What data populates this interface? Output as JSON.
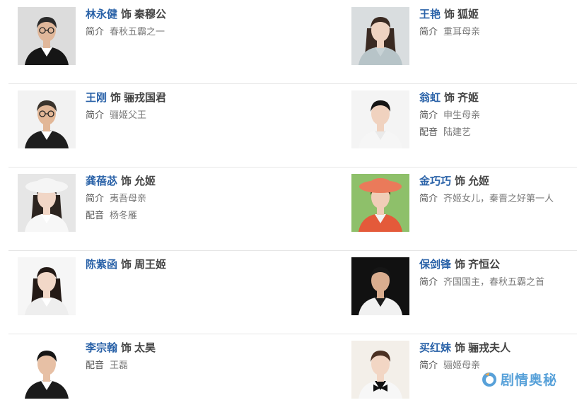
{
  "sep": "饰",
  "cast": [
    {
      "actor": "林永健",
      "role": "秦穆公",
      "details": [
        {
          "label": "简介",
          "value": "春秋五霸之一"
        }
      ],
      "photo": {
        "bg": "#dcdcdc",
        "skin": "#e0b79a",
        "hair": "#2a2a2a",
        "cloth": "#161616",
        "collar": "#ffffff",
        "glasses": true
      }
    },
    {
      "actor": "王艳",
      "role": "狐姬",
      "details": [
        {
          "label": "简介",
          "value": "重耳母亲"
        }
      ],
      "photo": {
        "bg": "#d9dddf",
        "skin": "#efd3c1",
        "hair": "#3a2a22",
        "cloth": "#b7c4c8",
        "collar": "#c8d3d6",
        "longhair": true
      }
    },
    {
      "actor": "王刚",
      "role": "骊戎国君",
      "details": [
        {
          "label": "简介",
          "value": "骊姬父王"
        }
      ],
      "photo": {
        "bg": "#f2f2f2",
        "skin": "#e2b797",
        "hair": "#3a332c",
        "cloth": "#1e1e1e",
        "collar": "#ffffff",
        "glasses": true
      }
    },
    {
      "actor": "翁虹",
      "role": "齐姬",
      "details": [
        {
          "label": "简介",
          "value": "申生母亲"
        },
        {
          "label": "配音",
          "value": "陆建艺"
        }
      ],
      "photo": {
        "bg": "#f4f4f4",
        "skin": "#f0d2bf",
        "hair": "#151515",
        "cloth": "#f6f6f6",
        "collar": "#eaeaea"
      }
    },
    {
      "actor": "龚蓓苾",
      "role": "允姬",
      "details": [
        {
          "label": "简介",
          "value": "夷吾母亲"
        },
        {
          "label": "配音",
          "value": "杨冬雁"
        }
      ],
      "photo": {
        "bg": "#e6e6e6",
        "skin": "#f1d6c6",
        "hair": "#2c241f",
        "cloth": "#f7f7f7",
        "collar": "#ffffff",
        "hat": "#f5f5f5",
        "longhair": true
      }
    },
    {
      "actor": "金巧巧",
      "role": "允姬",
      "details": [
        {
          "label": "简介",
          "value": "齐姬女儿，秦晋之好第一人"
        }
      ],
      "photo": {
        "bg": "#8ec06a",
        "skin": "#f0cdb7",
        "hair": "#3a2418",
        "cloth": "#e45a3a",
        "collar": "#f3f3f3",
        "hat": "#ea7a5a"
      }
    },
    {
      "actor": "陈紫函",
      "role": "周王姬",
      "details": [],
      "photo": {
        "bg": "#f6f6f6",
        "skin": "#f2d8c8",
        "hair": "#241a16",
        "cloth": "#eeeeee",
        "collar": "#ffffff",
        "longhair": true
      }
    },
    {
      "actor": "保剑锋",
      "role": "齐恒公",
      "details": [
        {
          "label": "简介",
          "value": "齐国国主，春秋五霸之首"
        }
      ],
      "photo": {
        "bg": "#111111",
        "skin": "#d9ad8f",
        "hair": "#161616",
        "cloth": "#f1f1f1",
        "collar": "#1b1b1b"
      }
    },
    {
      "actor": "李宗翰",
      "role": "太昊",
      "details": [
        {
          "label": "配音",
          "value": "王磊"
        }
      ],
      "photo": {
        "bg": "#ffffff",
        "skin": "#e7c0a5",
        "hair": "#161616",
        "cloth": "#1b1b1b",
        "collar": "#ffffff"
      }
    },
    {
      "actor": "买红妹",
      "role": "骊戎夫人",
      "details": [
        {
          "label": "简介",
          "value": "骊姬母亲"
        }
      ],
      "photo": {
        "bg": "#f3efe9",
        "skin": "#f2d6c4",
        "hair": "#4a3022",
        "cloth": "#f7f7f7",
        "collar": "#111111",
        "bow": true
      }
    }
  ],
  "watermark": {
    "text": "剧情奥秘",
    "icon": "watermark-logo-icon",
    "color": "#4a9ad6"
  }
}
